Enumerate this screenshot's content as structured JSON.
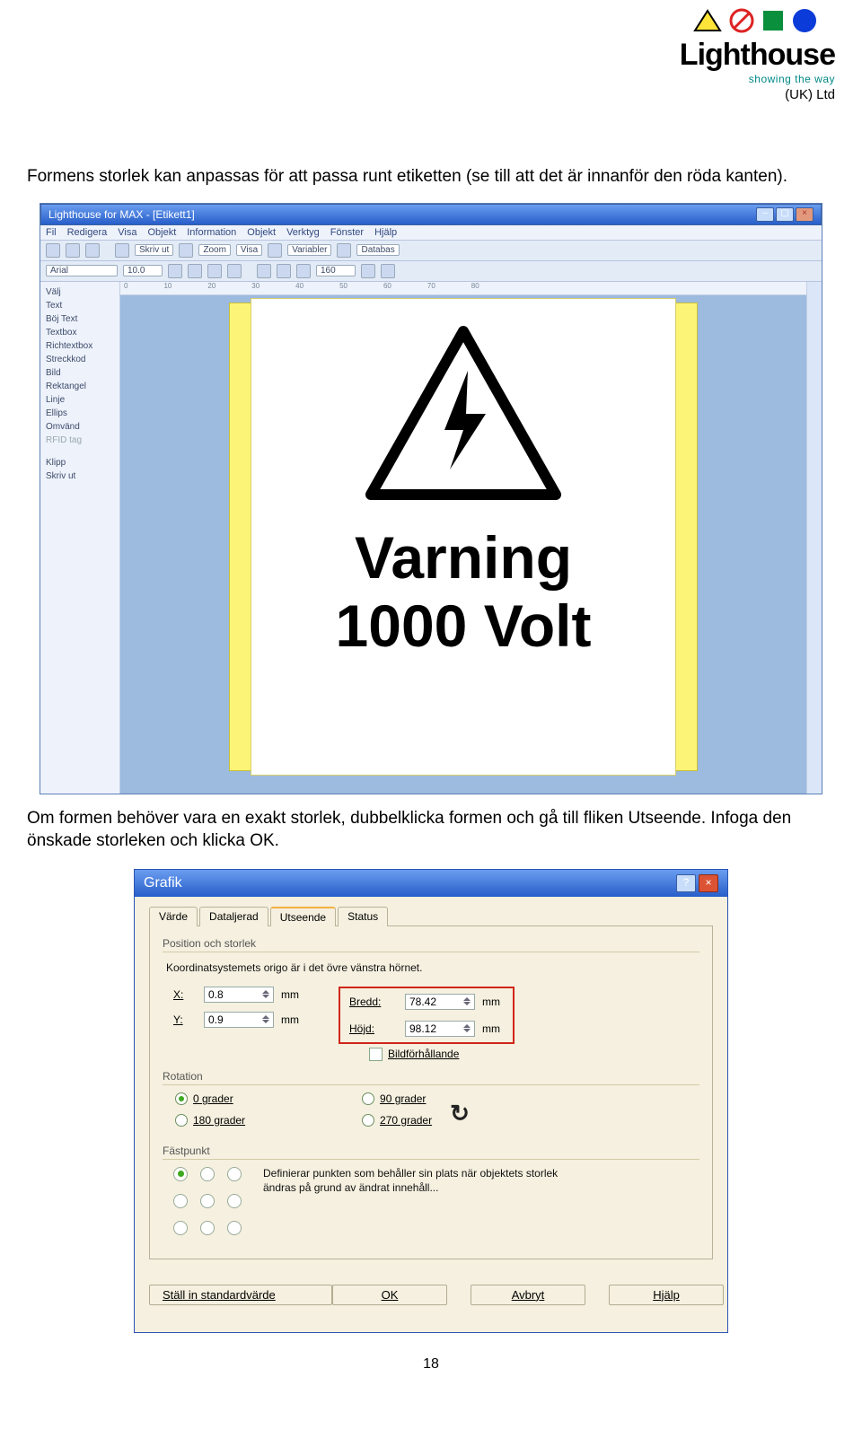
{
  "logo": {
    "name": "Lighthouse",
    "subtitle": "showing the way",
    "entity": "(UK) Ltd"
  },
  "intro": "Formens storlek kan anpassas för att passa runt etiketten (se till att det är innanför den röda kanten).",
  "app": {
    "title": "Lighthouse for MAX - [Etikett1]",
    "menus": [
      "Fil",
      "Redigera",
      "Visa",
      "Objekt",
      "Information",
      "Objekt",
      "Verktyg",
      "Fönster",
      "Hjälp"
    ],
    "toolbar": {
      "font": "Arial",
      "size": "10.0",
      "printbtn": "Skriv ut",
      "zoom": "Zoom",
      "visa": "Visa",
      "vars": "Variabler",
      "db": "Databas",
      "val160": "160"
    },
    "toolpanel": [
      "Välj",
      "Text",
      "Böj Text",
      "Textbox",
      "Richtextbox",
      "Streckkod",
      "Bild",
      "Rektangel",
      "Linje",
      "Ellips",
      "Omvänd",
      "RFID tag",
      "",
      "Klipp",
      "Skriv ut"
    ],
    "label": {
      "line1": "Varning",
      "line2": "1000 Volt"
    }
  },
  "middle": "Om formen behöver vara en exakt storlek, dubbelklicka formen och gå till fliken Utseende. Infoga den önskade storleken och klicka OK.",
  "dialog": {
    "title": "Grafik",
    "tabs": [
      "Värde",
      "Dataljerad",
      "Utseende",
      "Status"
    ],
    "posgroup": "Position och storlek",
    "origo": "Koordinatsystemets origo är i det övre vänstra hörnet.",
    "x": {
      "label": "X:",
      "val": "0.8",
      "unit": "mm"
    },
    "y": {
      "label": "Y:",
      "val": "0.9",
      "unit": "mm"
    },
    "bredd": {
      "label": "Bredd:",
      "val": "78.42",
      "unit": "mm"
    },
    "hojd": {
      "label": "Höjd:",
      "val": "98.12",
      "unit": "mm"
    },
    "aspect": "Bildförhållande",
    "rotation": "Rotation",
    "rot": {
      "g0": "0 grader",
      "g90": "90 grader",
      "g180": "180 grader",
      "g270": "270 grader"
    },
    "fast": "Fästpunkt",
    "fasttext": "Definierar punkten som behåller sin plats när objektets storlek ändras på grund av ändrat innehåll...",
    "buttons": {
      "std": "Ställ in standardvärde",
      "ok": "OK",
      "cancel": "Avbryt",
      "help": "Hjälp"
    }
  },
  "pagenum": "18"
}
